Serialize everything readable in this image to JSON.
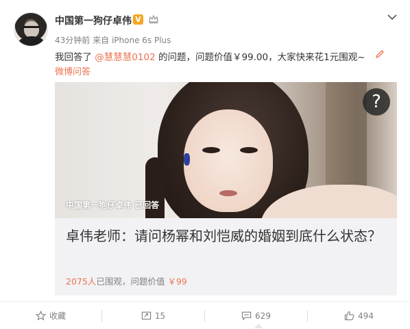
{
  "post": {
    "username": "中国第一狗仔卓伟",
    "verified_badge": "V",
    "time": "43分钟前",
    "source_prefix": "来自",
    "source": "iPhone 6s Plus",
    "text_before": "我回答了",
    "mention": "@慧慧慧0102",
    "text_after": "的问题，问题价值￥99.00，大家快来花1元围观~",
    "answer_link": "微博问答"
  },
  "card": {
    "question_mark": "?",
    "answered_overlay": "中国第一狗仔卓伟 已回答",
    "title": "卓伟老师：请问杨幂和刘恺威的婚姻到底什么状态？",
    "viewers": "2075人",
    "viewers_suffix": "已围观，问题价值",
    "price": "￥99"
  },
  "actions": {
    "favorite": "收藏",
    "repost": "15",
    "comment": "629",
    "like": "494"
  },
  "colors": {
    "accent": "#eb7350",
    "badge": "#f5a623"
  },
  "icons": [
    "dropdown-icon",
    "crown-icon",
    "pencil-icon",
    "star-icon",
    "repost-icon",
    "comment-icon",
    "like-icon"
  ]
}
